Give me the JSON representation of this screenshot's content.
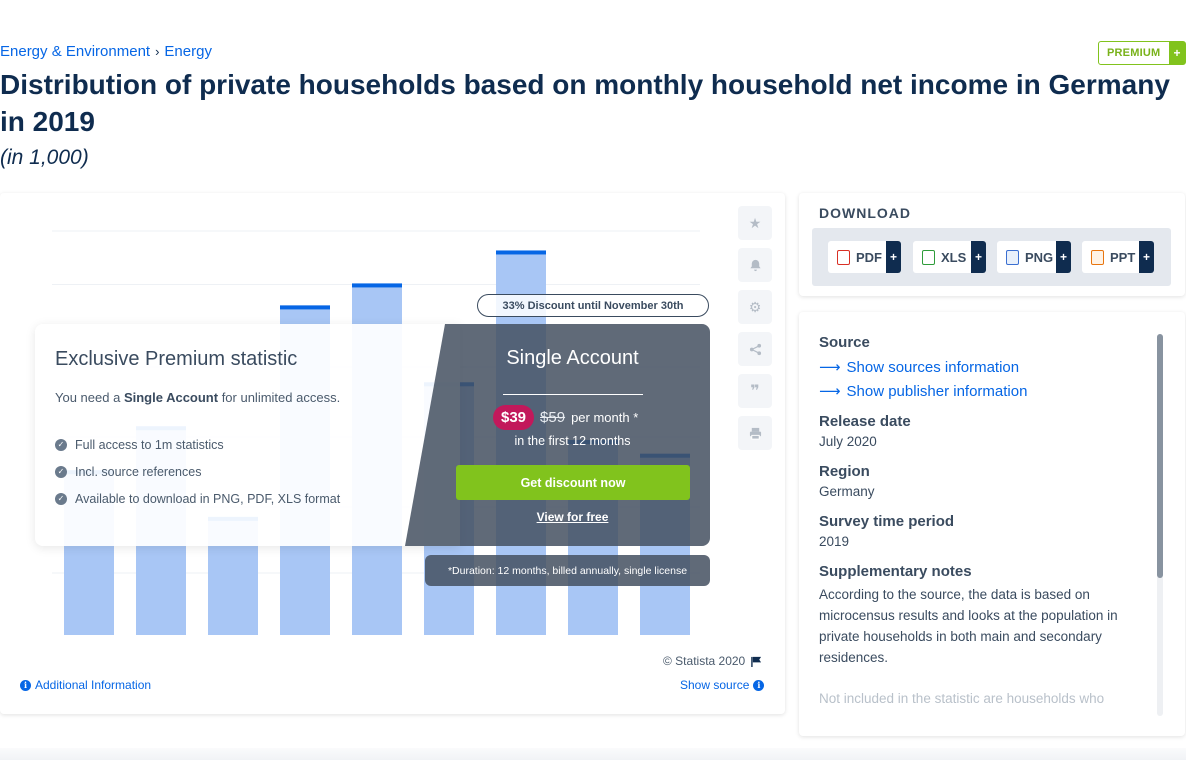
{
  "breadcrumb": {
    "items": [
      "Energy & Environment",
      "Energy"
    ],
    "separator": "›"
  },
  "premium_badge": {
    "label": "PREMIUM",
    "plus": "+"
  },
  "title": "Distribution of private households based on monthly household net income in Germany in 2019",
  "subtitle": "(in 1,000)",
  "chart_data": {
    "type": "bar",
    "categories": [],
    "values": [
      3000,
      3800,
      2150,
      6000,
      6400,
      4600,
      7000,
      3550,
      3300
    ],
    "ylim": [
      0,
      7500
    ],
    "bar_color": "#a8c6f5",
    "bar_top_color": "#0666e5",
    "grid": true
  },
  "tools": {
    "icons": [
      "star-icon",
      "bell-icon",
      "gear-icon",
      "share-icon",
      "quote-icon",
      "print-icon"
    ]
  },
  "overlay": {
    "title": "Exclusive Premium statistic",
    "need_prefix": "You need a ",
    "need_bold": "Single Account",
    "need_suffix": " for unlimited access.",
    "features": [
      "Full access to 1m statistics",
      "Incl. source references",
      "Available to download in PNG, PDF, XLS format"
    ],
    "discount_label": "33% Discount until November 30th",
    "account_title": "Single Account",
    "price_new": "$39",
    "price_old": "$59",
    "price_period": "per month *",
    "price_note": "in the first 12 months",
    "cta": "Get discount now",
    "free_link": "View for free",
    "duration_note": "*Duration: 12 months, billed annually, single license"
  },
  "chart_footer": {
    "copyright": "© Statista 2020",
    "additional_info": "Additional Information",
    "show_source": "Show source"
  },
  "download": {
    "title": "DOWNLOAD",
    "buttons": [
      {
        "label": "PDF",
        "color": "#d93025"
      },
      {
        "label": "XLS",
        "color": "#2e9c3a"
      },
      {
        "label": "PNG",
        "color": "#3b6fd1"
      },
      {
        "label": "PPT",
        "color": "#e8750e"
      }
    ],
    "plus": "+"
  },
  "info": {
    "source_label": "Source",
    "show_sources": "Show sources information",
    "show_publisher": "Show publisher information",
    "release_label": "Release date",
    "release_value": "July 2020",
    "region_label": "Region",
    "region_value": "Germany",
    "survey_label": "Survey time period",
    "survey_value": "2019",
    "notes_label": "Supplementary notes",
    "notes_text": "According to the source, the data is based on microcensus results and looks at the population in private households in both main and secondary residences.",
    "notes_more": "Not included in the statistic are households who"
  }
}
